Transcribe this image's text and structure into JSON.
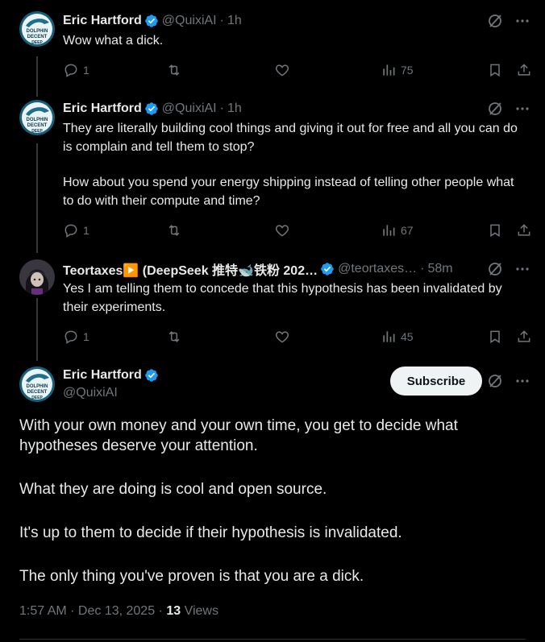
{
  "tweets": [
    {
      "name": "Eric Hartford",
      "handle": "@QuixiAI",
      "time": "1h",
      "text": [
        "Wow what a dick."
      ],
      "replies": "1",
      "views": "75"
    },
    {
      "name": "Eric Hartford",
      "handle": "@QuixiAI",
      "time": "1h",
      "text": [
        "They are literally building cool things and giving it out for free and all you can do is complain and tell them to stop?",
        "How about you spend your energy shipping instead of telling other people what to do with their compute and time?"
      ],
      "replies": "1",
      "views": "67"
    },
    {
      "name": "Teortaxes▶️ (DeepSeek 推特🐋铁粉 202…",
      "handle": "@teortaxes…",
      "time": "58m",
      "text": [
        "Yes I am telling them to concede that this hypothesis has been invalidated by their experiments."
      ],
      "replies": "1",
      "views": "45"
    }
  ],
  "main_tweet": {
    "name": "Eric Hartford",
    "handle": "@QuixiAI",
    "subscribe_label": "Subscribe",
    "text": [
      "With your own money and your own time, you get to decide what hypotheses deserve your attention.",
      "What they are doing is cool and open source.",
      "It's up to them to decide if their hypothesis is invalidated.",
      "The only thing you've proven is that you are a dick."
    ],
    "timestamp": "1:57 AM · Dec 13, 2025 · ",
    "views_count": "13",
    "views_label": " Views"
  },
  "avatar_text": [
    "DOLPHIN",
    "DECENT",
    "DEEP"
  ],
  "colors": {
    "background": "#000000",
    "text": "#e7e9ea",
    "secondary": "#71767b",
    "verified": "#1d9bf0",
    "subscribe_bg": "#eff3f4"
  },
  "icons": [
    "reply-icon",
    "retweet-icon",
    "like-icon",
    "views-icon",
    "bookmark-icon",
    "share-icon",
    "grok-icon",
    "more-icon",
    "verified-icon"
  ]
}
